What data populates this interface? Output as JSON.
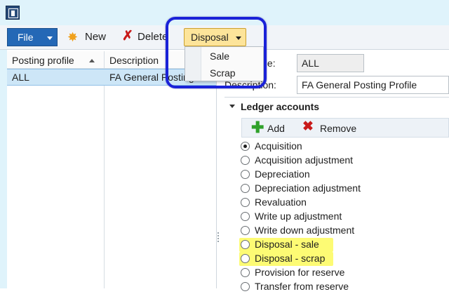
{
  "titlebar": {
    "fragment": ""
  },
  "toolbar": {
    "file_label": "File",
    "new_label": "New",
    "delete_label": "Delete",
    "disposal_label": "Disposal"
  },
  "disposal_menu": {
    "items": [
      {
        "label": "Sale"
      },
      {
        "label": "Scrap"
      }
    ]
  },
  "grid": {
    "columns": [
      {
        "label": "Posting profile"
      },
      {
        "label": "Description"
      }
    ],
    "rows": [
      {
        "posting_profile": "ALL",
        "description": "FA General Posting Profile"
      }
    ]
  },
  "details": {
    "posting_profile_label": "Posting profile:",
    "posting_profile_value": "ALL",
    "description_label": "Description:",
    "description_value": "FA General Posting Profile"
  },
  "ledger_accounts": {
    "title": "Ledger accounts",
    "add_label": "Add",
    "remove_label": "Remove",
    "options": [
      {
        "label": "Acquisition",
        "selected": true,
        "highlighted": false
      },
      {
        "label": "Acquisition adjustment",
        "selected": false,
        "highlighted": false
      },
      {
        "label": "Depreciation",
        "selected": false,
        "highlighted": false
      },
      {
        "label": "Depreciation adjustment",
        "selected": false,
        "highlighted": false
      },
      {
        "label": "Revaluation",
        "selected": false,
        "highlighted": false
      },
      {
        "label": "Write up adjustment",
        "selected": false,
        "highlighted": false
      },
      {
        "label": "Write down adjustment",
        "selected": false,
        "highlighted": false
      },
      {
        "label": "Disposal - sale",
        "selected": false,
        "highlighted": true
      },
      {
        "label": "Disposal - scrap",
        "selected": false,
        "highlighted": true
      },
      {
        "label": "Provision for reserve",
        "selected": false,
        "highlighted": false
      },
      {
        "label": "Transfer from reserve",
        "selected": false,
        "highlighted": false
      }
    ]
  },
  "colors": {
    "highlight_ring": "#1a22d8",
    "highlight_fill": "#fdfb74",
    "selected_row": "#cde6f7",
    "file_button": "#2468b6",
    "disposal_button": "#fde49a"
  }
}
